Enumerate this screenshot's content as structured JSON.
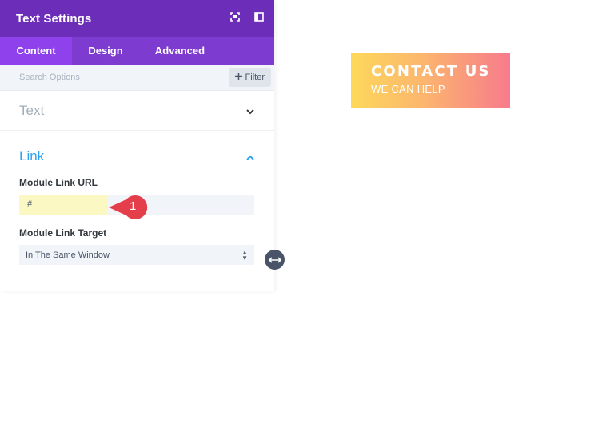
{
  "panel": {
    "title": "Text Settings",
    "header_icons": [
      "expand-icon",
      "sidebar-toggle-icon"
    ],
    "tabs": [
      {
        "label": "Content",
        "active": true
      },
      {
        "label": "Design",
        "active": false
      },
      {
        "label": "Advanced",
        "active": false
      }
    ],
    "search": {
      "placeholder": "Search Options",
      "filter_label": "Filter",
      "filter_icon": "plus-icon"
    },
    "sections": {
      "text": {
        "title": "Text",
        "expanded": false,
        "icon": "chevron-down-icon"
      },
      "link": {
        "title": "Link",
        "expanded": true,
        "icon": "chevron-up-icon",
        "url_label": "Module Link URL",
        "url_value": "#",
        "target_label": "Module Link Target",
        "target_value": "In The Same Window"
      }
    }
  },
  "annotation": {
    "number": "1",
    "color": "#e53e4b"
  },
  "preview": {
    "title": "CONTACT US",
    "subtitle": "WE CAN HELP",
    "gradient": [
      "#fdd85a",
      "#f77b8c"
    ]
  },
  "colors": {
    "header": "#6c2eb9",
    "tabs": "#7e3bd0",
    "active_tab": "#8f42ec",
    "link_accent": "#2ea3f2"
  }
}
